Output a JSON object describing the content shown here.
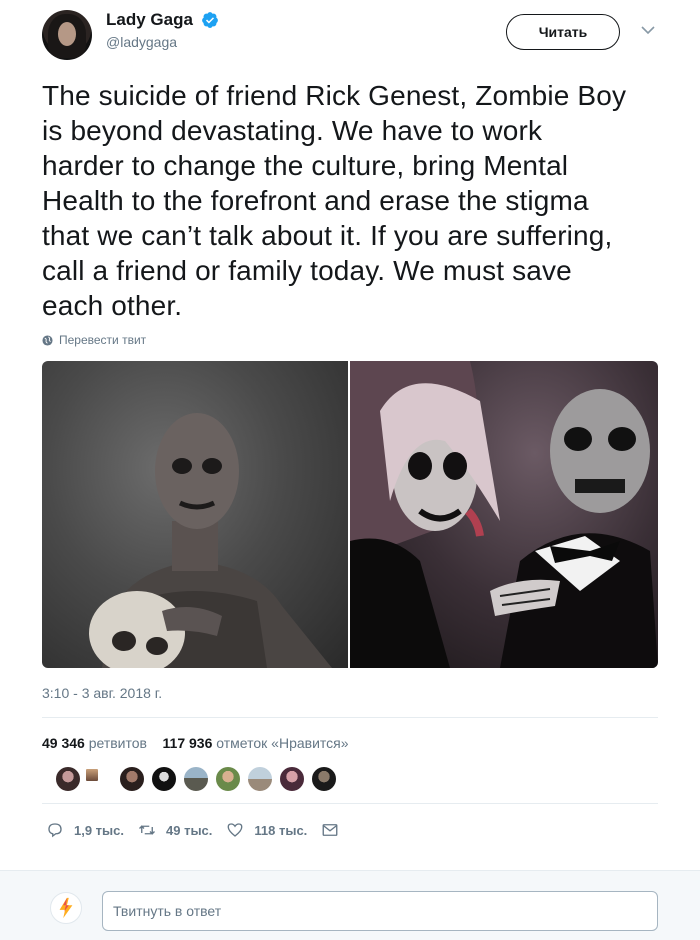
{
  "author": {
    "name": "Lady Gaga",
    "handle": "@ladygaga",
    "verified_icon": "verified-badge-icon",
    "avatar_icon": "profile-avatar"
  },
  "header": {
    "follow_label": "Читать",
    "caret_icon": "chevron-down-icon"
  },
  "tweet": {
    "lines": [
      "The suicide of friend Rick Genest, Zombie Boy",
      "is beyond devastating. We have to work",
      "harder to change the culture, bring Mental",
      "Health to the forefront and erase the stigma",
      "that we can’t talk about it. If you are suffering,",
      "call a friend or family today. We must save",
      "each other."
    ],
    "translate_label": "Перевести твит",
    "timestamp": "3:10 - 3 авг. 2018 г."
  },
  "stats": {
    "retweets_count": "49 346",
    "retweets_label": "ретвитов",
    "likes_count": "117 936",
    "likes_label": "отметок «Нравится»"
  },
  "actions": {
    "replies": "1,9 тыс.",
    "retweets": "49 тыс.",
    "likes": "118 тыс."
  },
  "reply": {
    "placeholder": "Твитнуть в ответ"
  },
  "colors": {
    "verified": "#1da1f2",
    "text": "#14171a",
    "secondary": "#657786",
    "reply_accent": "#ffad1f"
  }
}
